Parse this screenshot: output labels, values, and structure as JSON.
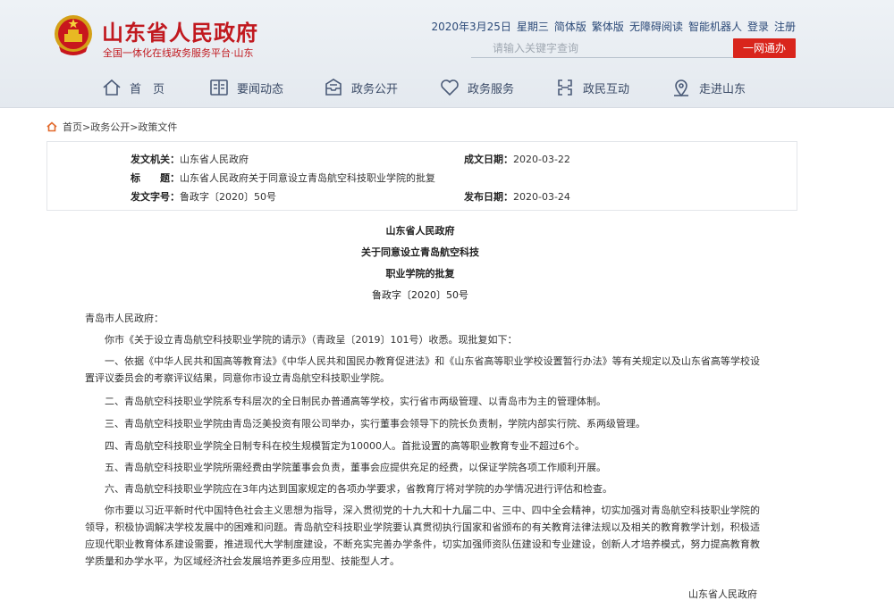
{
  "header": {
    "site_title": "山东省人民政府",
    "site_subtitle": "全国一体化在线政务服务平台·山东",
    "date": "2020年3月25日",
    "weekday": "星期三",
    "links": [
      "简体版",
      "繁体版",
      "无障碍阅读",
      "智能机器人",
      "登录",
      "注册"
    ],
    "search_placeholder": "请输入关键字查询",
    "search_button": "一网通办",
    "brand_color": "#c1191f"
  },
  "nav": {
    "items": [
      {
        "label": "首　页",
        "icon": "home-icon"
      },
      {
        "label": "要闻动态",
        "icon": "news-icon"
      },
      {
        "label": "政务公开",
        "icon": "inbox-icon"
      },
      {
        "label": "政务服务",
        "icon": "heart-icon"
      },
      {
        "label": "政民互动",
        "icon": "link-icon"
      },
      {
        "label": "走进山东",
        "icon": "location-icon"
      }
    ]
  },
  "breadcrumb": "首页>政务公开>政策文件",
  "meta": {
    "issuer_label": "发文机关：",
    "issuer": "山东省人民政府",
    "title_label": "标　　题：",
    "title": "山东省人民政府关于同意设立青岛航空科技职业学院的批复",
    "doc_no_label": "发文字号：",
    "doc_no": "鲁政字〔2020〕50号",
    "written_label": "成文日期：",
    "written": "2020-03-22",
    "published_label": "发布日期：",
    "published": "2020-03-24"
  },
  "document": {
    "heading1": "山东省人民政府",
    "heading2": "关于同意设立青岛航空科技",
    "heading3": "职业学院的批复",
    "number": "鲁政字〔2020〕50号",
    "salutation": "青岛市人民政府：",
    "p1": "你市《关于设立青岛航空科技职业学院的请示》（青政呈〔2019〕101号）收悉。现批复如下：",
    "p2": "一、依据《中华人民共和国高等教育法》《中华人民共和国民办教育促进法》和《山东省高等职业学校设置暂行办法》等有关规定以及山东省高等学校设置评议委员会的考察评议结果，同意你市设立青岛航空科技职业学院。",
    "p3": "二、青岛航空科技职业学院系专科层次的全日制民办普通高等学校，实行省市两级管理、以青岛市为主的管理体制。",
    "p4": "三、青岛航空科技职业学院由青岛泛美投资有限公司举办，实行董事会领导下的院长负责制，学院内部实行院、系两级管理。",
    "p5": "四、青岛航空科技职业学院全日制专科在校生规模暂定为10000人。首批设置的高等职业教育专业不超过6个。",
    "p6": "五、青岛航空科技职业学院所需经费由学院董事会负责，董事会应提供充足的经费，以保证学院各项工作顺利开展。",
    "p7": "六、青岛航空科技职业学院应在3年内达到国家规定的各项办学要求，省教育厅将对学院的办学情况进行评估和检查。",
    "p8": "你市要以习近平新时代中国特色社会主义思想为指导，深入贯彻党的十九大和十九届二中、三中、四中全会精神，切实加强对青岛航空科技职业学院的领导，积极协调解决学校发展中的困难和问题。青岛航空科技职业学院要认真贯彻执行国家和省颁布的有关教育法律法规以及相关的教育教学计划，积极适应现代职业教育体系建设需要，推进现代大学制度建设，不断充实完善办学条件，切实加强师资队伍建设和专业建设，创新人才培养模式，努力提高教育教学质量和办学水平，为区域经济社会发展培养更多应用型、技能型人才。",
    "signature": "山东省人民政府"
  }
}
